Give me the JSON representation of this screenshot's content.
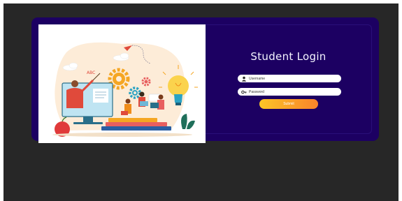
{
  "login": {
    "title": "Student Login",
    "username_placeholder": "Username",
    "password_placeholder": "Password",
    "submit_label": "Submit"
  },
  "illustration": {
    "board_text": "ABC"
  },
  "icons": {
    "username": "user-icon",
    "password": "key-icon"
  },
  "colors": {
    "page_background": "#272727",
    "card_background": "#1c0062",
    "title_text": "#f4f4ff",
    "button_gradient_start": "#fbc527",
    "button_gradient_end": "#f9832a"
  }
}
